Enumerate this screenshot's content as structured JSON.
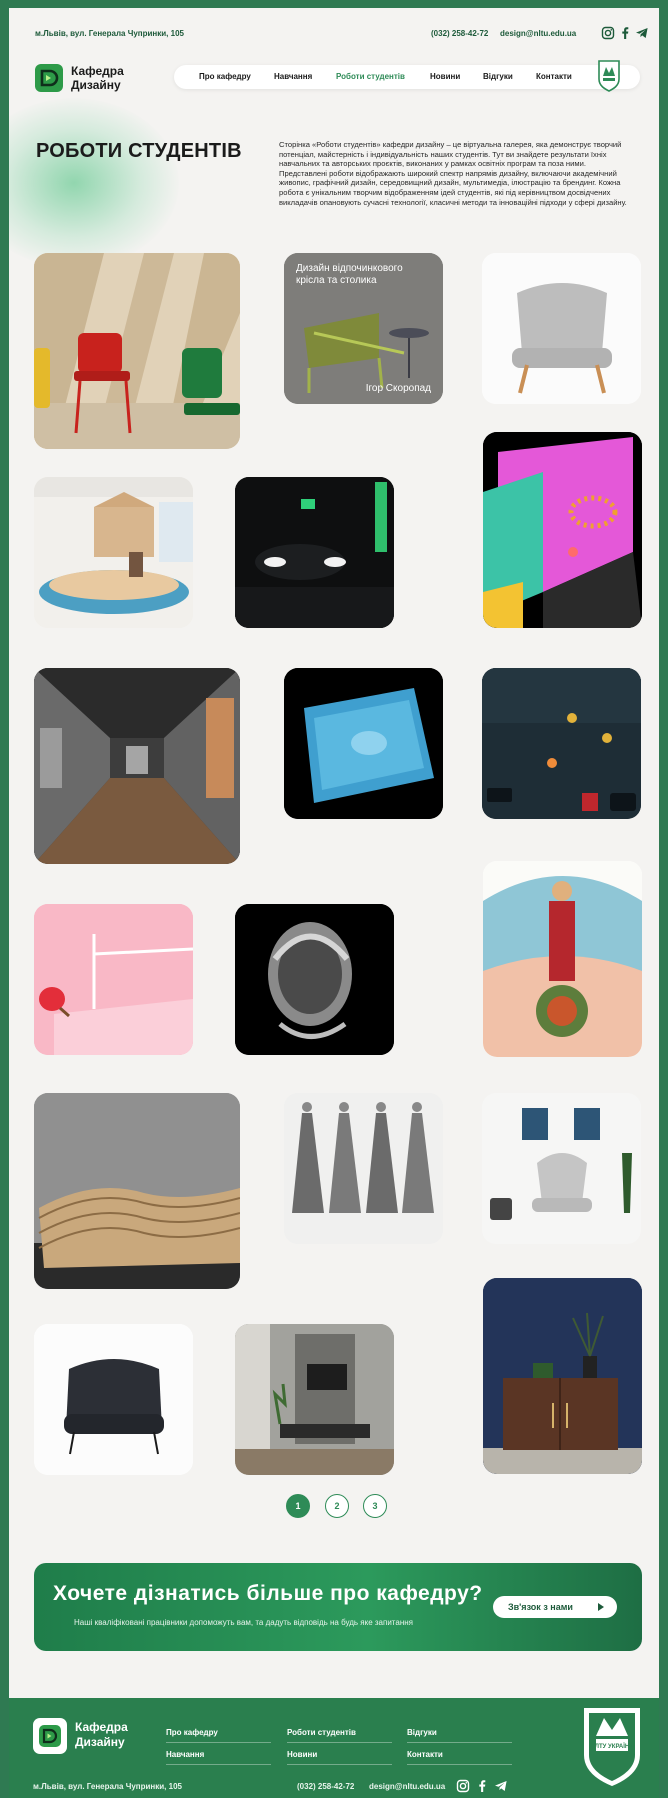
{
  "topbar": {
    "address": "м.Львів, вул. Генерала Чупринки, 105",
    "phone": "(032) 258-42-72",
    "email": "design@nltu.edu.ua"
  },
  "header": {
    "logo_line1": "Кафедра",
    "logo_line2": "Дизайну",
    "nav": [
      {
        "label": "Про кафедру"
      },
      {
        "label": "Навчання"
      },
      {
        "label": "Роботи студентів",
        "active": true
      },
      {
        "label": "Новини"
      },
      {
        "label": "Відгуки"
      },
      {
        "label": "Контакти"
      }
    ]
  },
  "intro": {
    "title": "РОБОТИ СТУДЕНТІВ",
    "paragraph1": "Сторінка «Роботи студентів» кафедри дизайну – це віртуальна галерея, яка демонструє творчий потенціал, майстерність і індивідуальність наших студентів. Тут ви знайдете результати їхніх навчальних та авторських проєктів, виконаних у рамках освітніх програм та поза ними.",
    "paragraph2": "Представлені роботи відображають широкий спектр напрямів дизайну, включаючи академічний живопис, графічний дизайн, середовищний дизайн, мультимедіа, ілюстрацію та брендинг. Кожна робота є унікальним творчим відображенням ідей студентів, які під керівництвом досвідчених викладачів опановують сучасні технології, класичні методи та інноваційні підходи у сфері дизайну."
  },
  "gallery": {
    "featured_caption_title": "Дизайн відпочинкового крісла та столика",
    "featured_caption_author": "Ігор Скоропад"
  },
  "pagination": {
    "pages": [
      "1",
      "2",
      "3"
    ],
    "current": "1"
  },
  "cta": {
    "title": "Хочете дізнатись більше про кафедру?",
    "subtitle": "Наші кваліфіковані працівники допоможуть вам, та дадуть відповідь на будь яке запитання",
    "button_label": "Зв'язок з нами"
  },
  "footer": {
    "logo_line1": "Кафедра",
    "logo_line2": "Дизайну",
    "links": [
      "Про кафедру",
      "Навчання",
      "Роботи студентів",
      "Новини",
      "Відгуки",
      "Контакти"
    ],
    "address": "м.Львів, вул. Генерала Чупринки, 105",
    "phone": "(032) 258-42-72",
    "email": "design@nltu.edu.ua",
    "crest_text": "НЛТУ УКРАЇНИ"
  },
  "colors": {
    "brand_green": "#2e8b57",
    "dark_green": "#1d5a3a",
    "background": "#f4f3f1",
    "footer": "#2a7f4e"
  },
  "icons": [
    "instagram-icon",
    "facebook-icon",
    "telegram-icon",
    "arrow-right-icon"
  ]
}
